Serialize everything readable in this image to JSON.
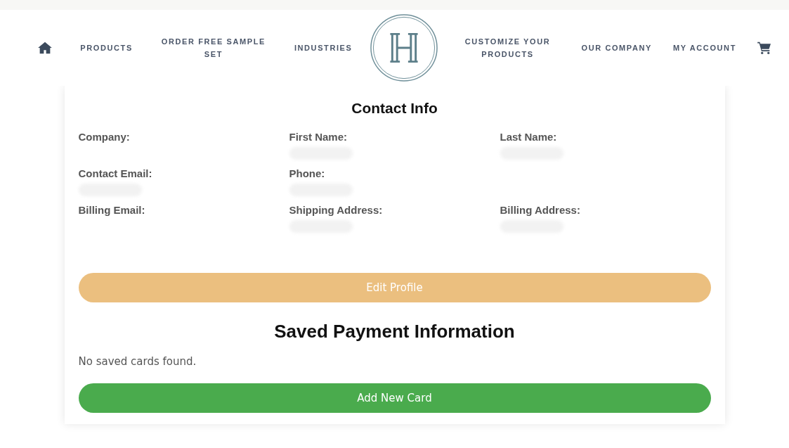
{
  "nav": {
    "left": [
      {
        "kind": "home"
      },
      {
        "kind": "link",
        "label": "PRODUCTS"
      },
      {
        "kind": "link",
        "label": "ORDER FREE SAMPLE SET"
      },
      {
        "kind": "link",
        "label": "INDUSTRIES"
      }
    ],
    "right": [
      {
        "kind": "link",
        "label": "CUSTOMIZE YOUR PRODUCTS"
      },
      {
        "kind": "link",
        "label": "OUR COMPANY"
      },
      {
        "kind": "link",
        "label": "MY ACCOUNT"
      },
      {
        "kind": "cart"
      }
    ]
  },
  "contact": {
    "title": "Contact Info",
    "rows": [
      [
        {
          "label": "Company:",
          "redacted": false
        },
        {
          "label": "First Name:",
          "redacted": true
        },
        {
          "label": "Last Name:",
          "redacted": true
        }
      ],
      [
        {
          "label": "Contact Email:",
          "redacted": true
        },
        {
          "label": "Phone:",
          "redacted": true
        }
      ],
      [
        {
          "label": "Billing Email:",
          "redacted": false
        },
        {
          "label": "Shipping Address:",
          "redacted": true
        },
        {
          "label": "Billing Address:",
          "redacted": true
        }
      ]
    ],
    "button": "Edit Profile"
  },
  "payment": {
    "title": "Saved Payment Information",
    "message": "No saved cards found.",
    "button": "Add New Card"
  }
}
